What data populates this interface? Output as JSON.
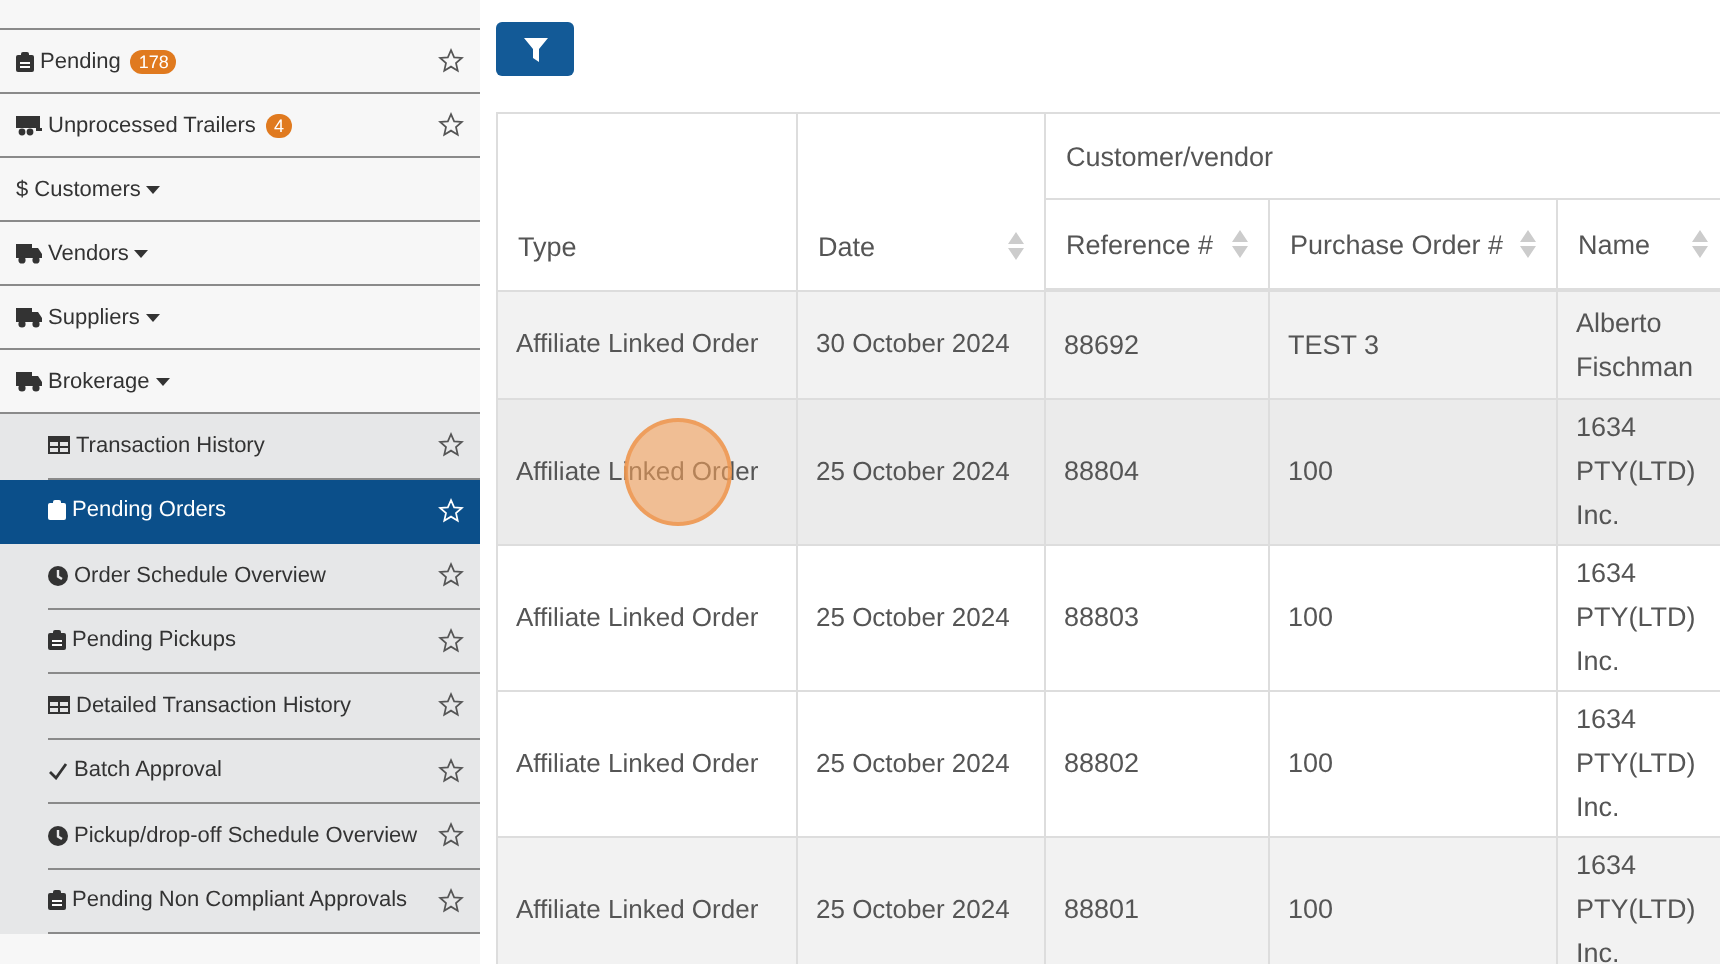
{
  "sidebar": {
    "items": [
      {
        "label": "Pending",
        "badge": "178",
        "starred": false
      },
      {
        "label": "Unprocessed Trailers",
        "badge": "4",
        "starred": false
      },
      {
        "label": "$ Customers"
      },
      {
        "label": "Vendors"
      },
      {
        "label": "Suppliers"
      },
      {
        "label": "Brokerage",
        "expanded": true,
        "children": [
          {
            "label": "Transaction History",
            "selected": false,
            "starred": false
          },
          {
            "label": "Pending Orders",
            "selected": true,
            "starred": false
          },
          {
            "label": "Order Schedule Overview",
            "selected": false,
            "starred": false
          },
          {
            "label": "Pending Pickups",
            "selected": false,
            "starred": false
          },
          {
            "label": "Detailed Transaction History",
            "selected": false,
            "starred": false
          },
          {
            "label": "Batch Approval",
            "selected": false,
            "starred": false
          },
          {
            "label": "Pickup/drop-off Schedule Overview",
            "selected": false,
            "starred": false
          },
          {
            "label": "Pending Non Compliant Approvals",
            "selected": false,
            "starred": false
          }
        ]
      }
    ]
  },
  "table": {
    "group_header": "Customer/vendor",
    "columns": [
      {
        "label": "Type",
        "sortable": false
      },
      {
        "label": "Date",
        "sortable": true
      },
      {
        "label": "Reference #",
        "sortable": true
      },
      {
        "label": "Purchase Order #",
        "sortable": true
      },
      {
        "label": "Name",
        "sortable": true
      }
    ],
    "rows": [
      {
        "shaded": true,
        "highlighted": false,
        "cells": [
          "Affiliate Linked Order",
          "30 October 2024",
          "88692",
          "TEST 3",
          "Alberto Fischman"
        ]
      },
      {
        "shaded": false,
        "highlighted": true,
        "cells": [
          "Affiliate Linked Order",
          "25 October 2024",
          "88804",
          "100",
          "1634 PTY(LTD) Inc."
        ]
      },
      {
        "shaded": false,
        "highlighted": false,
        "cells": [
          "Affiliate Linked Order",
          "25 October 2024",
          "88803",
          "100",
          "1634 PTY(LTD) Inc."
        ]
      },
      {
        "shaded": false,
        "highlighted": false,
        "cells": [
          "Affiliate Linked Order",
          "25 October 2024",
          "88802",
          "100",
          "1634 PTY(LTD) Inc."
        ]
      },
      {
        "shaded": true,
        "highlighted": false,
        "cells": [
          "Affiliate Linked Order",
          "25 October 2024",
          "88801",
          "100",
          "1634 PTY(LTD) Inc."
        ]
      }
    ]
  }
}
